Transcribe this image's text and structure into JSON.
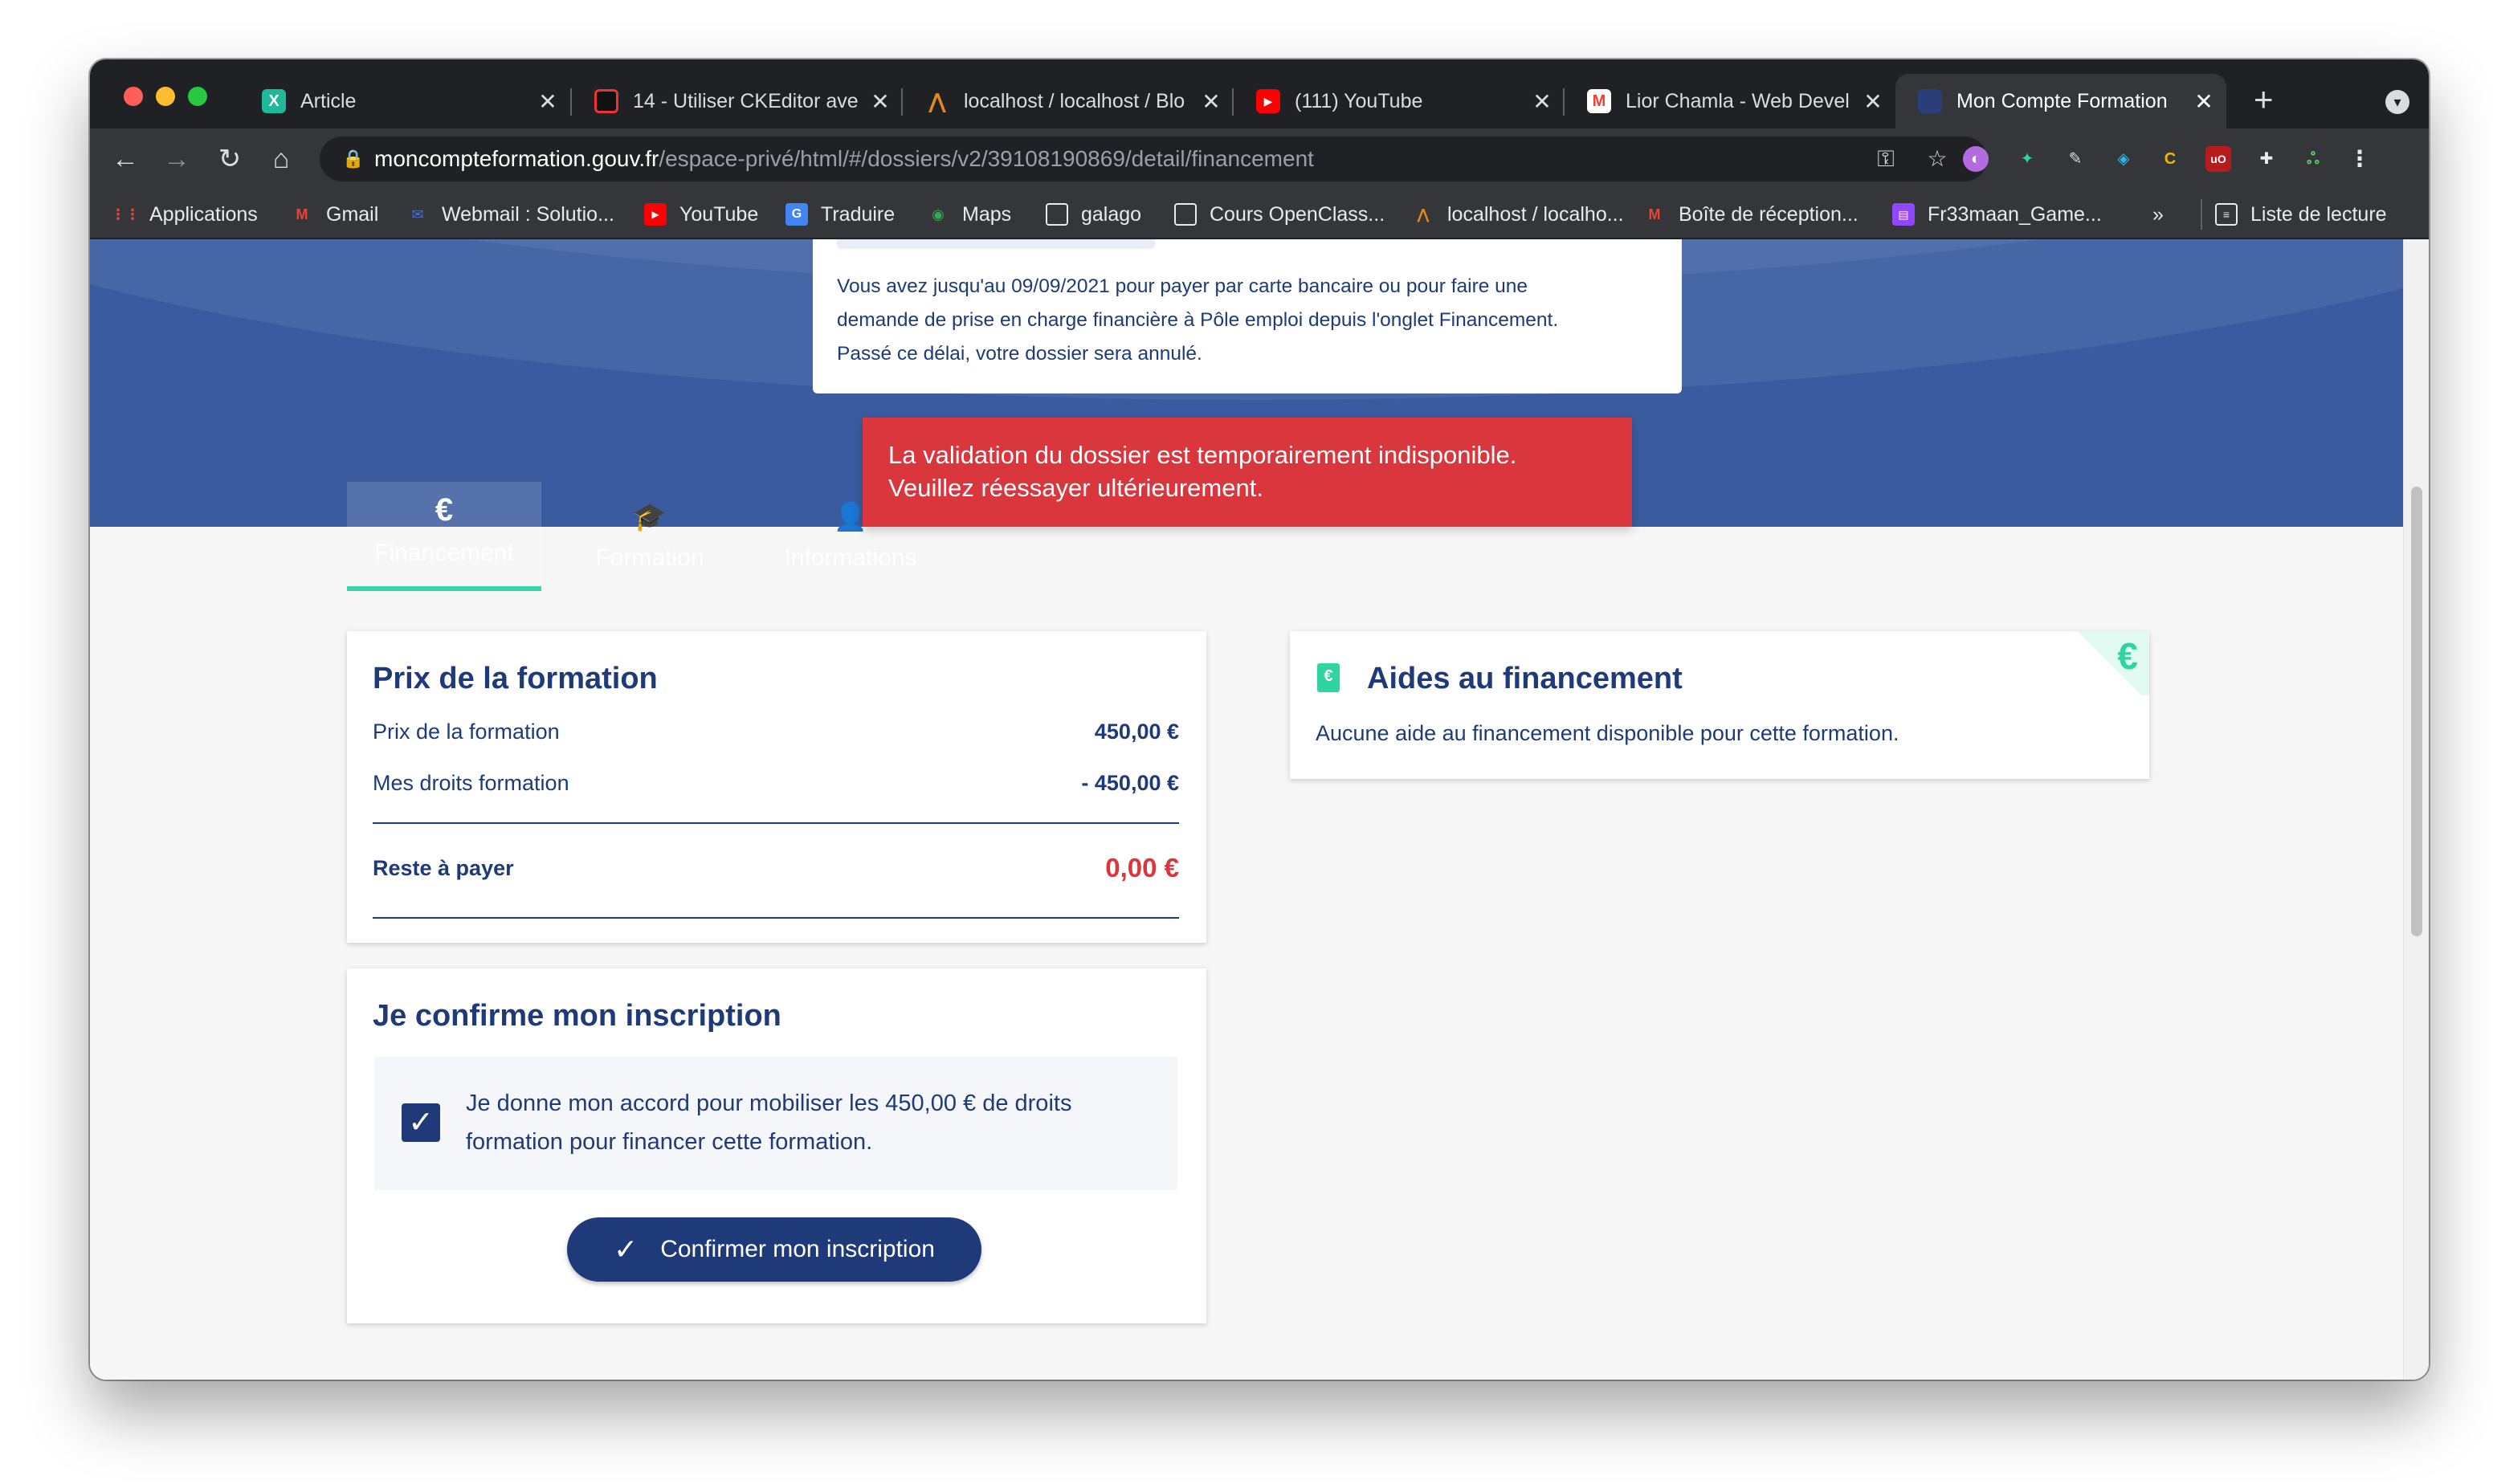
{
  "browser": {
    "tabs": [
      {
        "title": "Article",
        "favicon": "X",
        "favicon_color": "#1eb89a",
        "active": false
      },
      {
        "title": "14 - Utiliser CKEditor ave",
        "favicon": "",
        "favicon_color": "#111111",
        "active": false
      },
      {
        "title": "localhost / localhost / Blo",
        "favicon": "",
        "favicon_color": "#e48a1c",
        "active": false
      },
      {
        "title": "(111) YouTube",
        "favicon": "▶",
        "favicon_color": "#ff0000",
        "active": false
      },
      {
        "title": "Lior Chamla - Web Devel",
        "favicon": "M",
        "favicon_color": "#ea4335",
        "active": false
      },
      {
        "title": "Mon Compte Formation",
        "favicon": "",
        "favicon_color": "#2a3f7a",
        "active": true
      }
    ],
    "url_host": "moncompteformation.gouv.fr",
    "url_path": "/espace-privé/html/#/dossiers/v2/39108190869/detail/financement",
    "bookmarks": [
      {
        "label": "Applications",
        "icon": "apps-grid-icon"
      },
      {
        "label": "Gmail",
        "icon": "gmail-icon"
      },
      {
        "label": "Webmail : Solutio...",
        "icon": "webmail-icon"
      },
      {
        "label": "YouTube",
        "icon": "youtube-icon"
      },
      {
        "label": "Traduire",
        "icon": "translate-icon"
      },
      {
        "label": "Maps",
        "icon": "maps-icon"
      },
      {
        "label": "galago",
        "icon": "folder-icon"
      },
      {
        "label": "Cours OpenClass...",
        "icon": "folder-icon"
      },
      {
        "label": "localhost / localho...",
        "icon": "phpmyadmin-icon"
      },
      {
        "label": "Boîte de réception...",
        "icon": "gmail-icon"
      },
      {
        "label": "Fr33maan_Game...",
        "icon": "twitch-icon"
      },
      {
        "label": "»",
        "icon": ""
      },
      {
        "label": "Liste de lecture",
        "icon": "reading-list-icon"
      }
    ]
  },
  "notice": {
    "line1": "Vous avez jusqu'au 09/09/2021 pour payer par carte bancaire ou pour faire une",
    "line2": "demande de prise en charge financière à Pôle emploi depuis l'onglet Financement.",
    "line3": "Passé ce délai, votre dossier sera annulé."
  },
  "toast": {
    "line1": "La validation du dossier est temporairement indisponible.",
    "line2": "Veuillez réessayer ultérieurement."
  },
  "nav_tabs": [
    {
      "label": "Financement",
      "icon": "€",
      "active": true
    },
    {
      "label": "Formation",
      "icon": "🎓",
      "active": false
    },
    {
      "label": "Informations",
      "icon": "👤",
      "active": false
    }
  ],
  "price_card": {
    "title": "Prix de la formation",
    "rows": [
      {
        "label": "Prix de la formation",
        "value": "450,00 €"
      },
      {
        "label": "Mes droits formation",
        "value": "- 450,00 €"
      }
    ],
    "total_label": "Reste à payer",
    "total_value": "0,00 €"
  },
  "confirm_card": {
    "title": "Je confirme mon inscription",
    "consent_line1": "Je donne mon accord pour mobiliser les 450,00 € de droits",
    "consent_line2": "formation pour financer cette formation.",
    "checked": true,
    "button_label": "Confirmer mon inscription"
  },
  "aid_card": {
    "title": "Aides au financement",
    "text": "Aucune aide au financement disponible pour cette formation."
  },
  "colors": {
    "brand_blue": "#1e3a78",
    "hero_blue": "#3a5b9f",
    "accent_green": "#38d6a8",
    "error_red": "#d9363e",
    "total_red": "#d9363e"
  }
}
